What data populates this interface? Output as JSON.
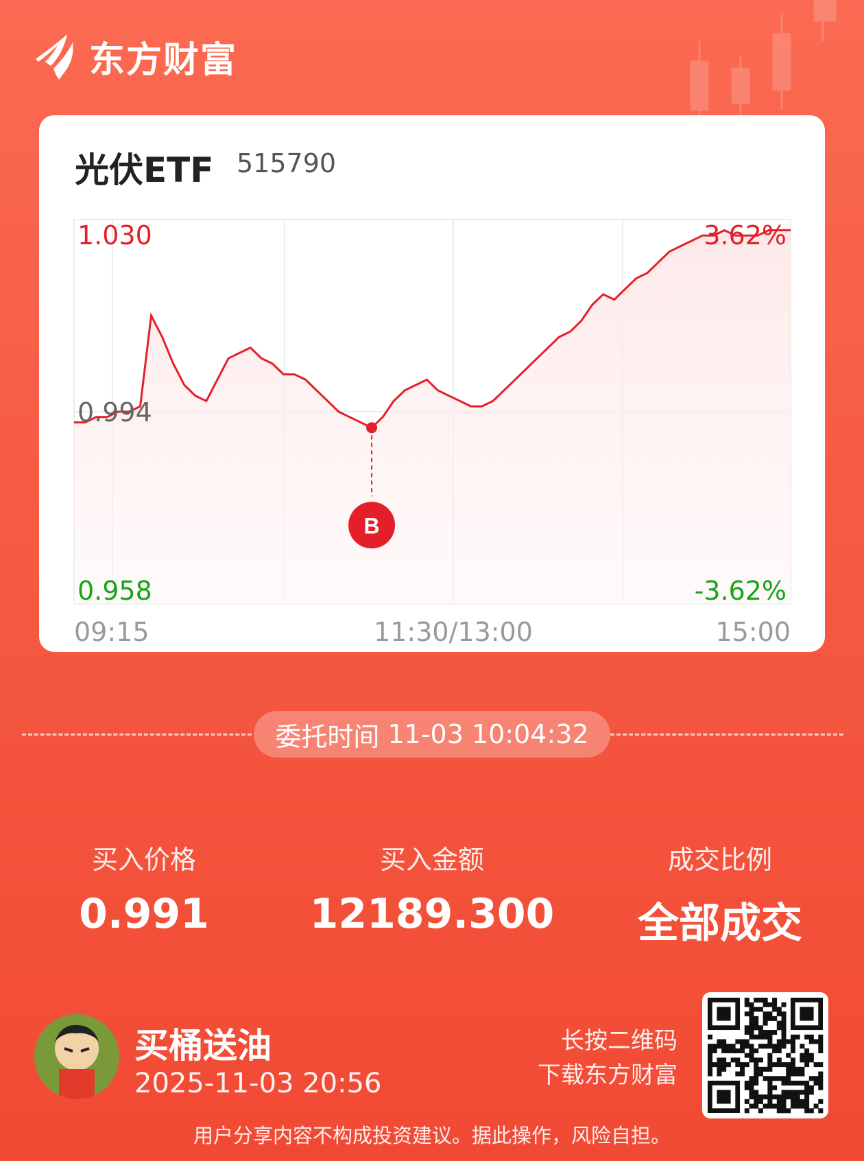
{
  "brand": {
    "name": "东方财富",
    "logo_icon": "dongfang-caifu-logo"
  },
  "security": {
    "name": "光伏ETF",
    "code": "515790"
  },
  "chart_data": {
    "type": "line",
    "yaxis": {
      "top": "1.030",
      "mid": "0.994",
      "bottom": "0.958"
    },
    "pct": {
      "top": "3.62%",
      "bottom": "-3.62%"
    },
    "ylim": [
      0.958,
      1.03
    ],
    "reference": 0.994,
    "xlabels": {
      "start": "09:15",
      "mid": "11:30/13:00",
      "end": "15:00"
    },
    "buy_marker": {
      "label": "B",
      "index": 27
    },
    "series": [
      {
        "values": [
          0.992,
          0.992,
          0.993,
          0.993,
          0.994,
          0.994,
          0.995,
          1.012,
          1.008,
          1.003,
          0.999,
          0.997,
          0.996,
          1.0,
          1.004,
          1.005,
          1.006,
          1.004,
          1.003,
          1.001,
          1.001,
          1.0,
          0.998,
          0.996,
          0.994,
          0.993,
          0.992,
          0.991,
          0.993,
          0.996,
          0.998,
          0.999,
          1.0,
          0.998,
          0.997,
          0.996,
          0.995,
          0.995,
          0.996,
          0.998,
          1.0,
          1.002,
          1.004,
          1.006,
          1.008,
          1.009,
          1.011,
          1.014,
          1.016,
          1.015,
          1.017,
          1.019,
          1.02,
          1.022,
          1.024,
          1.025,
          1.026,
          1.027,
          1.027,
          1.028,
          1.027,
          1.027,
          1.027,
          1.028,
          1.028,
          1.028
        ]
      }
    ]
  },
  "order": {
    "time_label": "委托时间",
    "time_value": "11-03 10:04:32"
  },
  "stats": [
    {
      "label": "买入价格",
      "value": "0.991"
    },
    {
      "label": "买入金额",
      "value": "12189.300"
    },
    {
      "label": "成交比例",
      "value": "全部成交"
    }
  ],
  "user": {
    "name": "买桶送油",
    "time": "2025-11-03 20:56",
    "avatar_icon": "cartoon-avatar"
  },
  "qr": {
    "hint_line1": "长按二维码",
    "hint_line2": "下载东方财富",
    "icon": "qr-code-icon"
  },
  "disclaimer": "用户分享内容不构成投资建议。据此操作，风险自担。",
  "colors": {
    "up": "#e3202a",
    "down": "#1aa21a",
    "bg": "#f65a43"
  }
}
